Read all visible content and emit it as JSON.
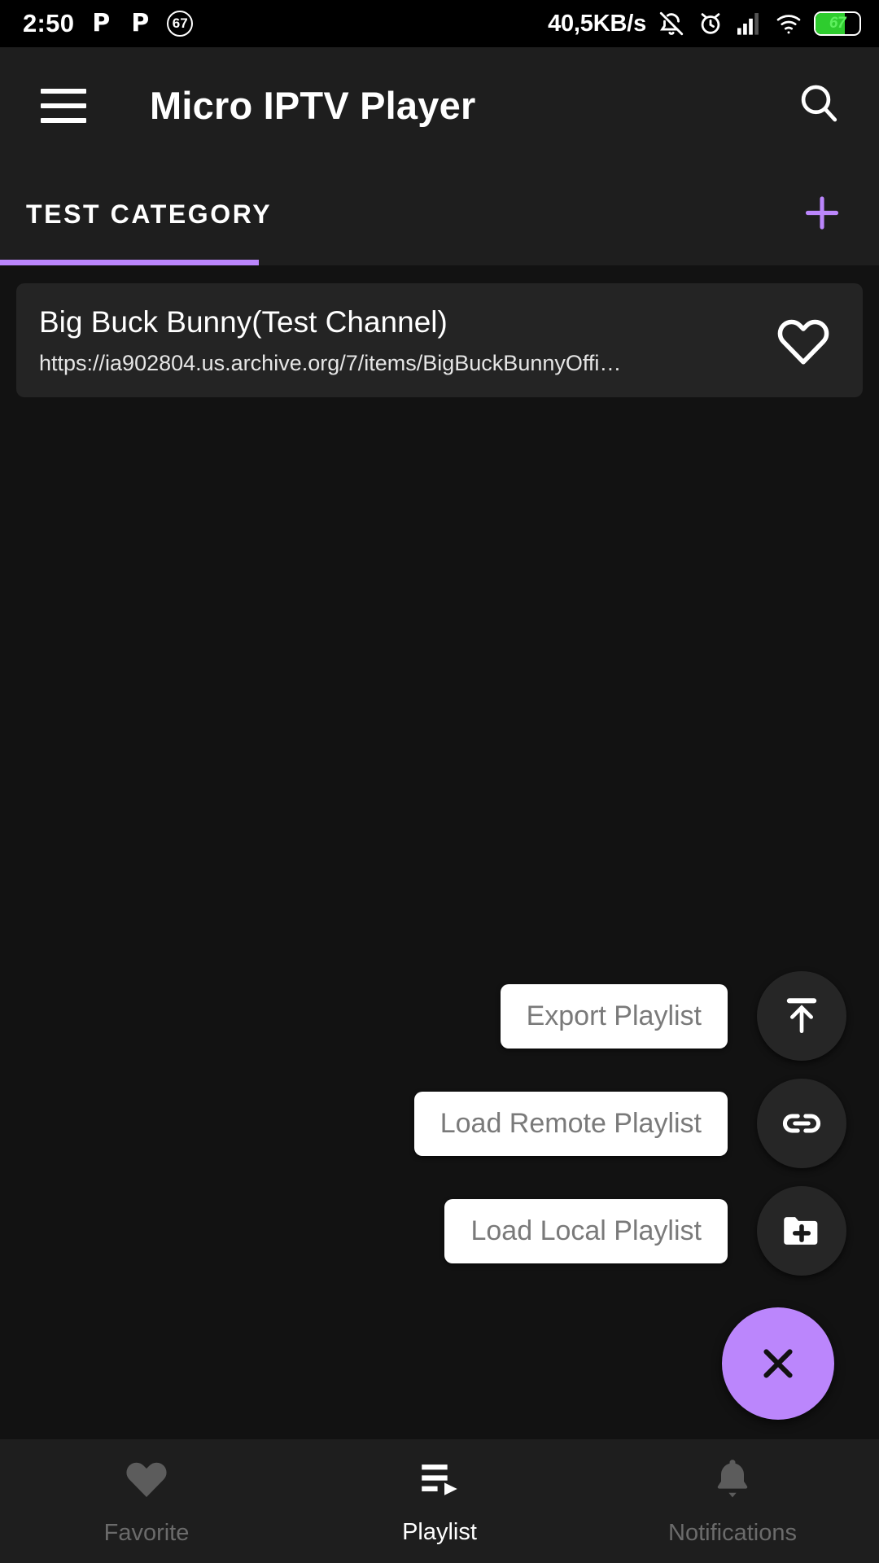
{
  "status_bar": {
    "time": "2:50",
    "app_badge_1": "P",
    "app_badge_2": "P",
    "circle_badge": "67",
    "network_speed": "40,5KB/s",
    "icons": [
      "notifications-off-icon",
      "alarm-icon",
      "signal-icon",
      "wifi-icon"
    ],
    "battery_percent": "67",
    "battery_color": "#2ecc2e"
  },
  "app_bar": {
    "menu_icon": "hamburger-menu-icon",
    "title": "Micro IPTV Player",
    "search_icon": "search-icon"
  },
  "tabs": {
    "items": [
      {
        "label": "TEST CATEGORY",
        "active": true
      }
    ],
    "add_icon": "plus-icon",
    "indicator_color": "#bb86fc",
    "add_color": "#bb86fc"
  },
  "channels": [
    {
      "name": "Big Buck Bunny(Test Channel)",
      "url": "https://ia902804.us.archive.org/7/items/BigBuckBunnyOffi…",
      "favorite_icon": "heart-outline-icon",
      "favorited": false
    }
  ],
  "speed_dial": {
    "expanded": true,
    "actions": [
      {
        "label": "Export Playlist",
        "icon": "upload-icon"
      },
      {
        "label": "Load Remote Playlist",
        "icon": "link-icon"
      },
      {
        "label": "Load Local Playlist",
        "icon": "folder-add-icon"
      }
    ],
    "main": {
      "icon": "close-icon",
      "color": "#bb86fc"
    }
  },
  "bottom_nav": {
    "items": [
      {
        "label": "Favorite",
        "icon": "heart-filled-icon",
        "active": false
      },
      {
        "label": "Playlist",
        "icon": "playlist-play-icon",
        "active": true
      },
      {
        "label": "Notifications",
        "icon": "bell-icon",
        "active": false
      }
    ]
  }
}
